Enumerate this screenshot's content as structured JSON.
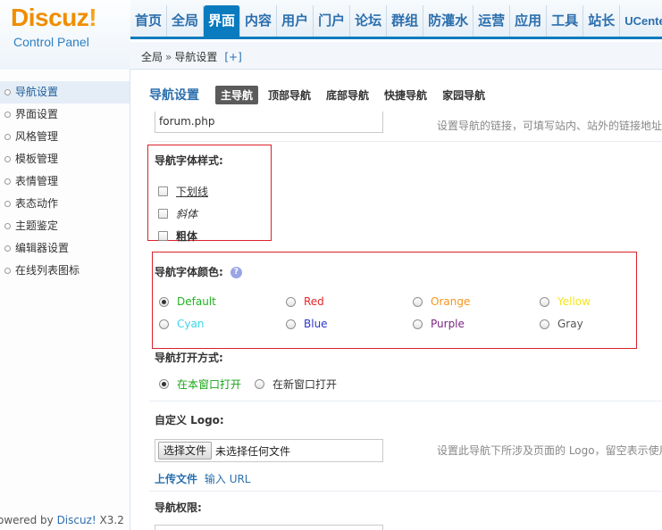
{
  "header": {
    "logo_text": "Discuz",
    "logo_exclaim": "!",
    "logo_sub": "Control Panel",
    "nav": [
      {
        "label": "首页",
        "active": false
      },
      {
        "label": "全局",
        "active": false
      },
      {
        "label": "界面",
        "active": true
      },
      {
        "label": "内容",
        "active": false
      },
      {
        "label": "用户",
        "active": false
      },
      {
        "label": "门户",
        "active": false
      },
      {
        "label": "论坛",
        "active": false
      },
      {
        "label": "群组",
        "active": false
      },
      {
        "label": "防灌水",
        "active": false
      },
      {
        "label": "运营",
        "active": false
      },
      {
        "label": "应用",
        "active": false
      },
      {
        "label": "工具",
        "active": false
      },
      {
        "label": "站长",
        "active": false
      },
      {
        "label": "UCenter",
        "active": false
      }
    ],
    "accent_color": "#0a7bbf"
  },
  "breadcrumb": {
    "root": "全局",
    "sep": "»",
    "current": "导航设置",
    "add": "[+]"
  },
  "sidebar": {
    "items": [
      {
        "label": "导航设置",
        "active": true
      },
      {
        "label": "界面设置",
        "active": false
      },
      {
        "label": "风格管理",
        "active": false
      },
      {
        "label": "模板管理",
        "active": false
      },
      {
        "label": "表情管理",
        "active": false
      },
      {
        "label": "表态动作",
        "active": false
      },
      {
        "label": "主题鉴定",
        "active": false
      },
      {
        "label": "编辑器设置",
        "active": false
      },
      {
        "label": "在线列表图标",
        "active": false
      }
    ],
    "powered_prefix": "owered by ",
    "powered_brand": "Discuz!",
    "powered_version": " X3.2"
  },
  "main": {
    "title": "导航设置",
    "tabs": [
      {
        "label": "主导航",
        "active": true
      },
      {
        "label": "顶部导航",
        "active": false
      },
      {
        "label": "底部导航",
        "active": false
      },
      {
        "label": "快捷导航",
        "active": false
      },
      {
        "label": "家园导航",
        "active": false
      }
    ],
    "link_value": "forum.php",
    "link_tip": "设置导航的链接，可填写站内、站外的链接地址",
    "font_style": {
      "label": "导航字体样式:",
      "options": [
        {
          "label": "下划线",
          "checked": false
        },
        {
          "label": "斜体",
          "checked": false
        },
        {
          "label": "粗体",
          "checked": false
        }
      ]
    },
    "font_color": {
      "label": "导航字体颜色:",
      "help_icon": "question-icon",
      "options": [
        {
          "label": "Default",
          "color": "#22b322",
          "checked": true
        },
        {
          "label": "Red",
          "color": "#e8272a",
          "checked": false
        },
        {
          "label": "Orange",
          "color": "#f7941d",
          "checked": false
        },
        {
          "label": "Yellow",
          "color": "#f4e51c",
          "checked": false
        },
        {
          "label": "Cyan",
          "color": "#3ad7e8",
          "checked": false
        },
        {
          "label": "Blue",
          "color": "#2b35c9",
          "checked": false
        },
        {
          "label": "Purple",
          "color": "#7a2582",
          "checked": false
        },
        {
          "label": "Gray",
          "color": "#555555",
          "checked": false
        }
      ]
    },
    "open_mode": {
      "label": "导航打开方式:",
      "options": [
        {
          "label": "在本窗口打开",
          "color": "#19a519",
          "checked": true
        },
        {
          "label": "在新窗口打开",
          "color": "#333333",
          "checked": false
        }
      ]
    },
    "logo": {
      "label": "自定义 Logo:",
      "button": "选择文件",
      "no_file": "未选择任何文件",
      "tip": "设置此导航下所涉及页面的 Logo，留空表示使用"
    },
    "upload": {
      "upload_label": "上传文件",
      "url_prefix": "输入",
      "url_label": "URL"
    },
    "permission_label": "导航权限:"
  }
}
